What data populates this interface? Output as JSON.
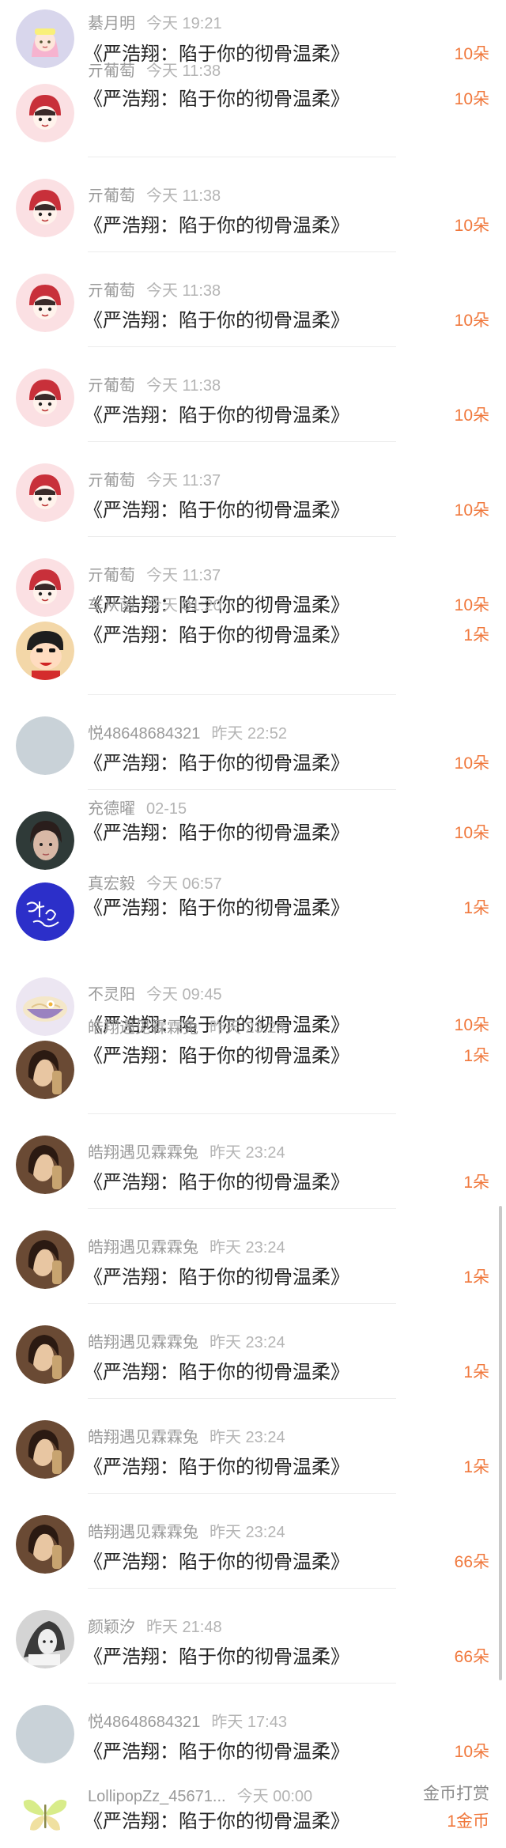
{
  "gift_list": [
    {
      "user": "綦月明",
      "time": "今天 19:21",
      "title": "《严浩翔：陷于你的彻骨温柔》",
      "amount": "10朵",
      "avatar": "cartoon-girl-pink-hair-avatar"
    },
    {
      "user": "亓葡萄",
      "time": "今天 11:38",
      "title": "《严浩翔：陷于你的彻骨温柔》",
      "amount": "10朵",
      "avatar": "red-bunny-hat-cartoon-avatar"
    },
    {
      "user": "亓葡萄",
      "time": "今天 11:38",
      "title": "《严浩翔：陷于你的彻骨温柔》",
      "amount": "10朵",
      "avatar": "red-bunny-hat-cartoon-avatar"
    },
    {
      "user": "亓葡萄",
      "time": "今天 11:38",
      "title": "《严浩翔：陷于你的彻骨温柔》",
      "amount": "10朵",
      "avatar": "red-bunny-hat-cartoon-avatar"
    },
    {
      "user": "亓葡萄",
      "time": "今天 11:38",
      "title": "《严浩翔：陷于你的彻骨温柔》",
      "amount": "10朵",
      "avatar": "red-bunny-hat-cartoon-avatar"
    },
    {
      "user": "亓葡萄",
      "time": "今天 11:37",
      "title": "《严浩翔：陷于你的彻骨温柔》",
      "amount": "10朵",
      "avatar": "red-bunny-hat-cartoon-avatar"
    },
    {
      "user": "亓葡萄",
      "time": "今天 11:37",
      "title": "《严浩翔：陷于你的彻骨温柔》",
      "amount": "10朵",
      "avatar": "red-bunny-hat-cartoon-avatar"
    },
    {
      "user": "车从菡",
      "time": "今天 01:20",
      "title": "《严浩翔：陷于你的彻骨温柔》",
      "amount": "1朵",
      "avatar": "crayon-shinchan-avatar"
    },
    {
      "user": "悦48648684321",
      "time": "昨天 22:52",
      "title": "《严浩翔：陷于你的彻骨温柔》",
      "amount": "10朵",
      "avatar": "default-grey-avatar"
    },
    {
      "user": "充德曜",
      "time": "02-15",
      "title": "《严浩翔：陷于你的彻骨温柔》",
      "amount": "10朵",
      "avatar": "dark-portrait-photo-avatar"
    },
    {
      "user": "真宏毅",
      "time": "今天 06:57",
      "title": "《严浩翔：陷于你的彻骨温柔》",
      "amount": "1朵",
      "avatar": "blue-handwriting-avatar"
    },
    {
      "user": "不灵阳",
      "time": "今天 09:45",
      "title": "《严浩翔：陷于你的彻骨温柔》",
      "amount": "10朵",
      "avatar": "noodle-bowl-avatar"
    },
    {
      "user": "皓翔遇见霖霖兔",
      "time": "昨天 23:24",
      "title": "《严浩翔：陷于你的彻骨温柔》",
      "amount": "1朵",
      "avatar": "brown-portrait-photo-avatar"
    },
    {
      "user": "皓翔遇见霖霖兔",
      "time": "昨天 23:24",
      "title": "《严浩翔：陷于你的彻骨温柔》",
      "amount": "1朵",
      "avatar": "brown-portrait-photo-avatar"
    },
    {
      "user": "皓翔遇见霖霖兔",
      "time": "昨天 23:24",
      "title": "《严浩翔：陷于你的彻骨温柔》",
      "amount": "1朵",
      "avatar": "brown-portrait-photo-avatar"
    },
    {
      "user": "皓翔遇见霖霖兔",
      "time": "昨天 23:24",
      "title": "《严浩翔：陷于你的彻骨温柔》",
      "amount": "1朵",
      "avatar": "brown-portrait-photo-avatar"
    },
    {
      "user": "皓翔遇见霖霖兔",
      "time": "昨天 23:24",
      "title": "《严浩翔：陷于你的彻骨温柔》",
      "amount": "1朵",
      "avatar": "brown-portrait-photo-avatar"
    },
    {
      "user": "皓翔遇见霖霖兔",
      "time": "昨天 23:24",
      "title": "《严浩翔：陷于你的彻骨温柔》",
      "amount": "66朵",
      "avatar": "brown-portrait-photo-avatar"
    },
    {
      "user": "颜颖汐",
      "time": "昨天 21:48",
      "title": "《严浩翔：陷于你的彻骨温柔》",
      "amount": "66朵",
      "avatar": "bw-portrait-photo-avatar"
    },
    {
      "user": "悦48648684321",
      "time": "昨天 17:43",
      "title": "《严浩翔：陷于你的彻骨温柔》",
      "amount": "10朵",
      "avatar": "default-grey-avatar"
    },
    {
      "user": "LollipopZz_45671...",
      "time": "今天 00:00",
      "title": "《严浩翔：陷于你的彻骨温柔》",
      "amount": "1金币",
      "label": "金币打赏",
      "avatar": "butterfly-avatar"
    }
  ],
  "colors": {
    "amount": "#f0783c",
    "username": "#9a9a9a",
    "title": "#222222",
    "divider": "#ececec"
  }
}
